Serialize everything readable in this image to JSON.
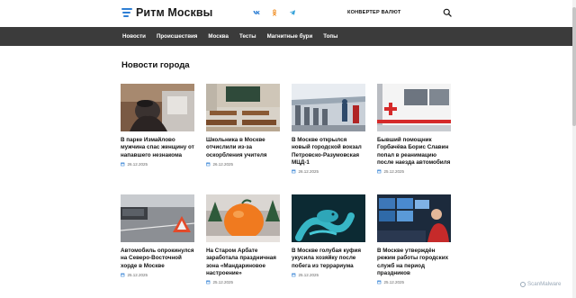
{
  "header": {
    "logo_text": "Ритм Москвы",
    "converter_label": "КОНВЕРТЕР ВАЛЮТ",
    "socials": [
      "vk-icon",
      "odnoklassniki-icon",
      "telegram-icon"
    ],
    "brand_color": "#2f7fd4"
  },
  "nav": {
    "items": [
      "Новости",
      "Происшествия",
      "Москва",
      "Тесты",
      "Магнитные бури",
      "Топы"
    ],
    "background": "#3b3b3b"
  },
  "section": {
    "title": "Новости города"
  },
  "cards": [
    {
      "title": "В парке Измайлово мужчина спас женщину от напавшего незнакома",
      "date": "26.12.2025"
    },
    {
      "title": "Школьника в Москве отчислили из-за оскорбления учителя",
      "date": "26.12.2025"
    },
    {
      "title": "В Москве открылся новый городской вокзал Петровско-Разумовская МЦД-1",
      "date": "26.12.2025"
    },
    {
      "title": "Бывший помощник Горбачёва Борис Славин попал в реанимацию после наезда автомобиля",
      "date": "25.12.2025"
    },
    {
      "title": "Автомобиль опрокинулся на Северо-Восточной хорде в Москве",
      "date": "25.12.2025"
    },
    {
      "title": "На Старом Арбате заработала праздничная зона «Мандариновое настроение»",
      "date": "25.12.2025"
    },
    {
      "title": "В Москве голубая куфия укусила хозяйку после побега из террариума",
      "date": "25.12.2025"
    },
    {
      "title": "В Москве утверждён режим работы городских служб на период праздников",
      "date": "25.12.2025"
    }
  ],
  "watermark": "ScanMalware"
}
